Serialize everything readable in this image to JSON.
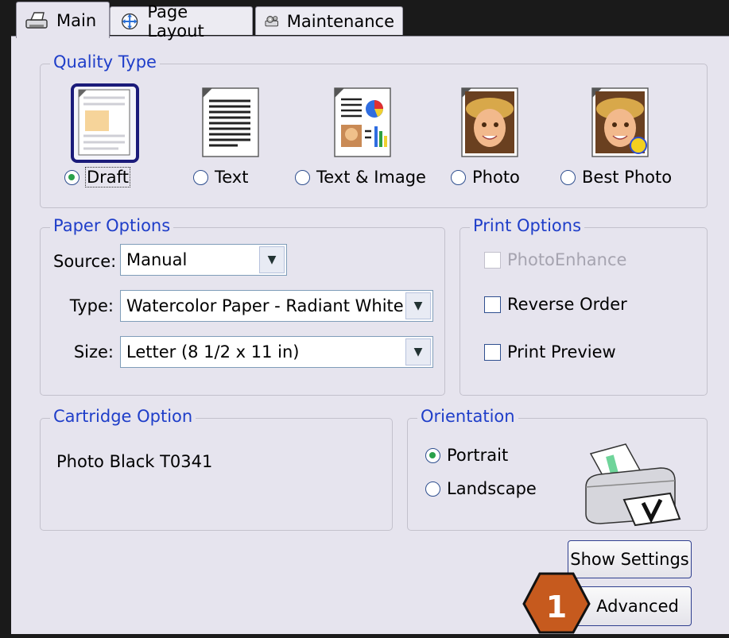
{
  "tabs": [
    {
      "label": "Main",
      "active": true
    },
    {
      "label": "Page Layout",
      "active": false
    },
    {
      "label": "Maintenance",
      "active": false
    }
  ],
  "quality_type": {
    "legend": "Quality Type",
    "options": [
      {
        "label": "Draft",
        "selected": true
      },
      {
        "label": "Text",
        "selected": false
      },
      {
        "label": "Text & Image",
        "selected": false
      },
      {
        "label": "Photo",
        "selected": false
      },
      {
        "label": "Best Photo",
        "selected": false
      }
    ]
  },
  "paper_options": {
    "legend": "Paper Options",
    "source_label": "Source:",
    "source_value": "Manual",
    "type_label": "Type:",
    "type_value": "Watercolor Paper - Radiant White",
    "size_label": "Size:",
    "size_value": "Letter (8 1/2 x 11 in)"
  },
  "print_options": {
    "legend": "Print Options",
    "photoenhance": {
      "label": "PhotoEnhance",
      "checked": false,
      "disabled": true
    },
    "reverse_order": {
      "label": "Reverse Order",
      "checked": false
    },
    "print_preview": {
      "label": "Print Preview",
      "checked": false
    }
  },
  "cartridge_option": {
    "legend": "Cartridge Option",
    "value": "Photo Black T0341"
  },
  "orientation": {
    "legend": "Orientation",
    "portrait": {
      "label": "Portrait",
      "selected": true
    },
    "landscape": {
      "label": "Landscape",
      "selected": false
    }
  },
  "buttons": {
    "show_settings": "Show Settings",
    "advanced": "Advanced"
  },
  "callout": "1",
  "colors": {
    "accent_text": "#1f3ec9",
    "panel_bg": "#e6e4ee",
    "badge_fill": "#c65a1e",
    "radio_dot": "#2aa14a"
  }
}
